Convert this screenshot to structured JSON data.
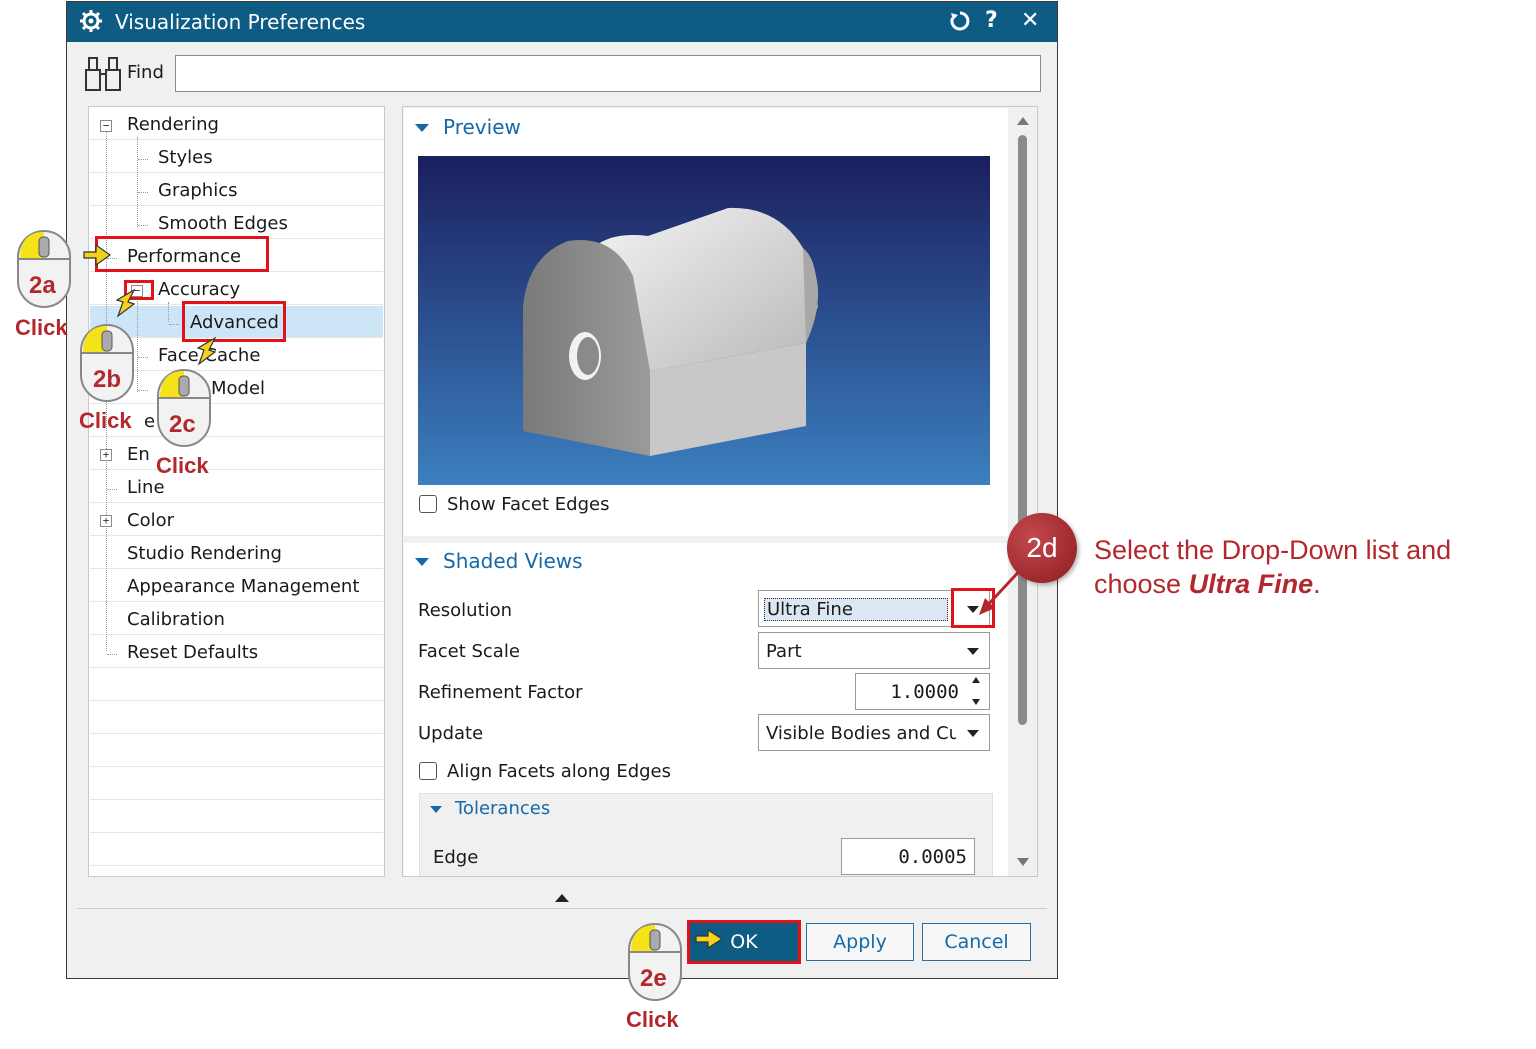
{
  "window": {
    "title": "Visualization Preferences",
    "reset_icon": "reset-icon",
    "help_label": "?",
    "close_label": "✕"
  },
  "find": {
    "label": "Find",
    "value": ""
  },
  "tree": {
    "items": [
      {
        "label": "Rendering",
        "expander": "−"
      },
      {
        "label": "Styles"
      },
      {
        "label": "Graphics"
      },
      {
        "label": "Smooth Edges"
      },
      {
        "label": "Performance"
      },
      {
        "label": "Accuracy",
        "expander": "−"
      },
      {
        "label": "Advanced",
        "selected": true
      },
      {
        "label": "Face Cache"
      },
      {
        "label": "Model"
      },
      {
        "label": "e"
      },
      {
        "label": "En",
        "expander": "+"
      },
      {
        "label": "Line"
      },
      {
        "label": "Color",
        "expander": "+"
      },
      {
        "label": "Studio Rendering"
      },
      {
        "label": "Appearance Management"
      },
      {
        "label": "Calibration"
      },
      {
        "label": "Reset Defaults"
      }
    ]
  },
  "preview": {
    "title": "Preview",
    "show_facet_edges_label": "Show Facet Edges",
    "show_facet_edges_checked": false
  },
  "shaded_views": {
    "title": "Shaded Views",
    "resolution_label": "Resolution",
    "resolution_value": "Ultra Fine",
    "facet_scale_label": "Facet Scale",
    "facet_scale_value": "Part",
    "refinement_label": "Refinement Factor",
    "refinement_value": "1.0000",
    "update_label": "Update",
    "update_value": "Visible Bodies and Cur",
    "align_label": "Align Facets along Edges",
    "align_checked": false,
    "tolerances_title": "Tolerances",
    "edge_label": "Edge",
    "edge_value": "0.0005"
  },
  "buttons": {
    "ok": "OK",
    "apply": "Apply",
    "cancel": "Cancel"
  },
  "annotations": {
    "step_2a": "2a",
    "step_2b": "2b",
    "step_2c": "2c",
    "step_2d": "2d",
    "step_2e": "2e",
    "click": "Click",
    "note_line1": "Select the Drop-Down list and",
    "note_pre": "choose ",
    "note_emphasis": "Ultra Fine",
    "note_post": ".",
    "accent_color": "#b3282d",
    "box_color": "#e0131b"
  },
  "colors": {
    "titlebar": "#0e5c84",
    "section_title": "#1569a8",
    "selection": "#cde6f7"
  }
}
